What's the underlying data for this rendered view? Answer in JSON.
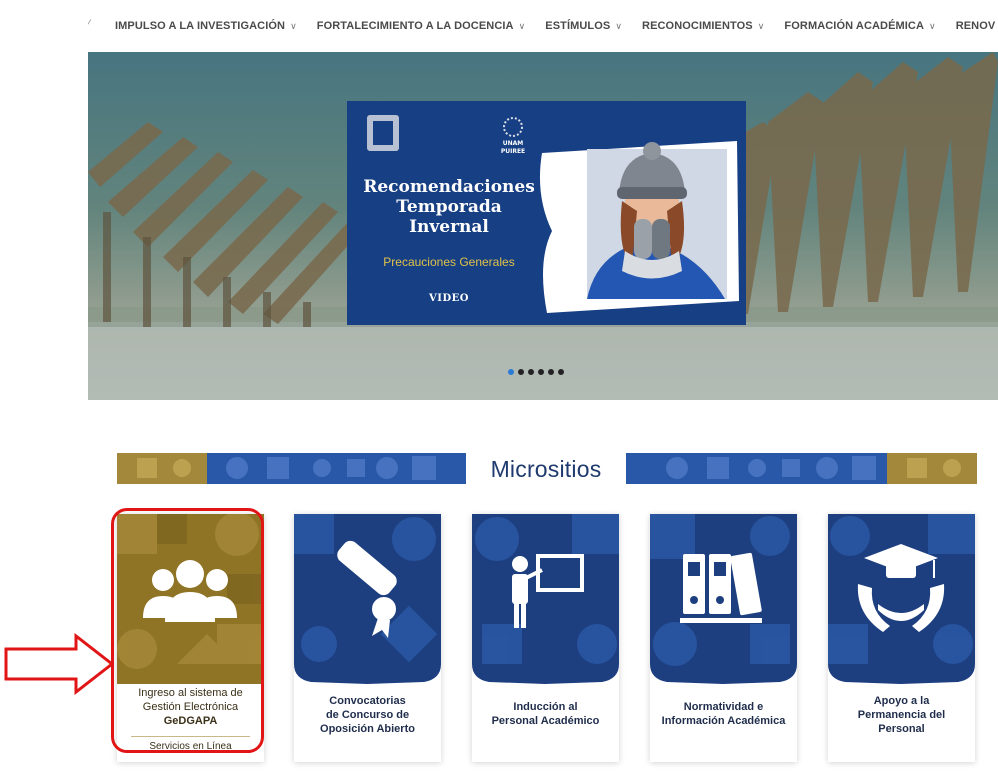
{
  "nav": {
    "items": [
      {
        "label": "IMPULSO A LA INVESTIGACIÓN"
      },
      {
        "label": "FORTALECIMIENTO A LA DOCENCIA"
      },
      {
        "label": "ESTÍMULOS"
      },
      {
        "label": "RECONOCIMIENTOS"
      },
      {
        "label": "FORMACIÓN ACADÉMICA"
      },
      {
        "label": "RENOV"
      }
    ]
  },
  "hero": {
    "promo": {
      "title_line1": "Recomendaciones",
      "title_line2": "Temporada",
      "title_line3": "Invernal",
      "subtitle": "Precauciones Generales",
      "cta": "VIDEO",
      "logo_text": "UNAM PUIREE"
    },
    "carousel": {
      "slides": 6,
      "active": 1
    }
  },
  "micrositios": {
    "heading": "Micrositios",
    "cards": [
      {
        "line1": "Ingreso al sistema de",
        "line2": "Gestión Electrónica",
        "line3": "GeDGAPA",
        "sub": "Servicios en Línea",
        "icon": "users-group-icon"
      },
      {
        "line1": "Convocatorias",
        "line2": "de Concurso de",
        "line3": "Oposición Abierto",
        "icon": "diploma-icon"
      },
      {
        "line1": "Inducción al",
        "line2": "Personal Académico",
        "icon": "teacher-board-icon"
      },
      {
        "line1": "Normatividad e",
        "line2": "Información Académica",
        "icon": "binders-icon"
      },
      {
        "line1": "Apoyo a la",
        "line2": "Permanencia del",
        "line3": "Personal",
        "icon": "graduation-hands-icon"
      }
    ]
  },
  "colors": {
    "nav_text": "#4a4a4a",
    "promo_bg": "#173f83",
    "accent_gold": "#e0c24a",
    "card_gold": "#8f7426",
    "card_blue": "#1d3f80",
    "highlight_red": "#e11515",
    "dot_active": "#2a7bd6"
  }
}
